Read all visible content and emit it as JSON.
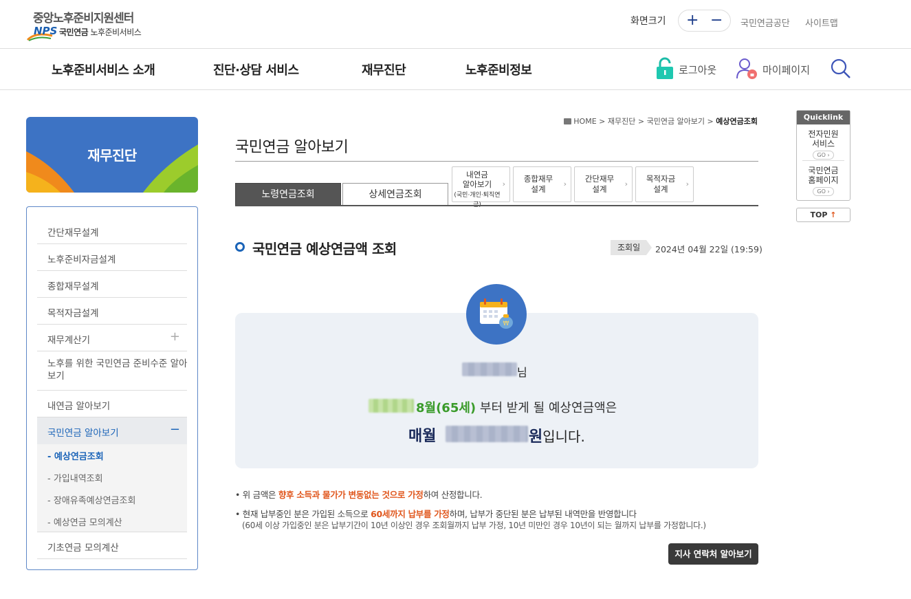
{
  "header": {
    "logo_title": "중앙노후준비지원센터",
    "logo_nps": "NPS",
    "logo_sub_bold": "국민연금",
    "logo_sub": "노후준비서비스",
    "font_size_label": "화면크기",
    "font_plus": "+",
    "font_minus": "−",
    "links": [
      "국민연금공단",
      "사이트맵"
    ]
  },
  "gnb": {
    "items": [
      "노후준비서비스 소개",
      "진단·상담 서비스",
      "재무진단",
      "노후준비정보"
    ],
    "logout_label": "로그아웃",
    "mypage_label": "마이페이지"
  },
  "lnb": {
    "title": "재무진단",
    "items": [
      "간단재무설계",
      "노후준비자금설계",
      "종합재무설계",
      "목적자금설계",
      "재무계산기",
      "노후를 위한 국민연금 준비수준 알아보기",
      "내연금 알아보기",
      "국민연금 알아보기",
      "기초연금 모의계산"
    ],
    "plus": "+",
    "minus": "−",
    "sub_items": [
      "예상연금조회",
      "가입내역조회",
      "장애유족예상연금조회",
      "예상연금 모의계산"
    ]
  },
  "breadcrumb": {
    "home": "HOME",
    "path": [
      "재무진단",
      "국민연금 알아보기"
    ],
    "current": "예상연금조회"
  },
  "page": {
    "title": "국민연금 알아보기",
    "tabs": [
      "노령연금조회",
      "상세연금조회"
    ],
    "mini_tabs": [
      {
        "line1": "내연금",
        "line2": "알아보기",
        "line3": "(국민·개인·퇴직연금)"
      },
      {
        "line1": "종합재무",
        "line2": "설계"
      },
      {
        "line1": "간단재무",
        "line2": "설계"
      },
      {
        "line1": "목적자금",
        "line2": "설계"
      }
    ]
  },
  "section": {
    "title": "국민연금 예상연금액 조회",
    "date_label": "조회일",
    "date_value": "2024년 04월 22일 (19:59)"
  },
  "result": {
    "name_suffix": "님",
    "age_text": "8월(65세)",
    "from_text": "부터 받게 될 예상연금액은",
    "monthly_label": "매월",
    "won": "원",
    "ends": "입니다."
  },
  "notes": {
    "n1_pre": "• 위 금액은 ",
    "n1_em": "향후 소득과 물가가 변동없는 것으로 가정",
    "n1_post": "하여 산정합니다.",
    "n2_pre": "• 현재 납부중인 분은 가입된 소득으로 ",
    "n2_em": "60세까지 납부를 가정",
    "n2_post": "하며, 납부가 중단된 분은 납부된 내역만을 반영합니다",
    "n2_sub": "(60세 이상 가입중인 분은 납부기간이 10년 이상인 경우 조회월까지 납부 가정, 10년 미만인 경우 10년이 되는 월까지 납부를 가정합니다.)"
  },
  "branch_button": "지사 연락처 알아보기",
  "quicklink": {
    "title": "Quicklink",
    "items": [
      {
        "l1": "전자민원",
        "l2": "서비스"
      },
      {
        "l1": "국민연금",
        "l2": "홈페이지"
      }
    ],
    "go": "GO",
    "top": "TOP"
  },
  "colors": {
    "brand_blue": "#3d73c4",
    "dark_tab": "#555555",
    "accent_orange": "#e0561c",
    "accent_green": "#3a9b2a"
  }
}
